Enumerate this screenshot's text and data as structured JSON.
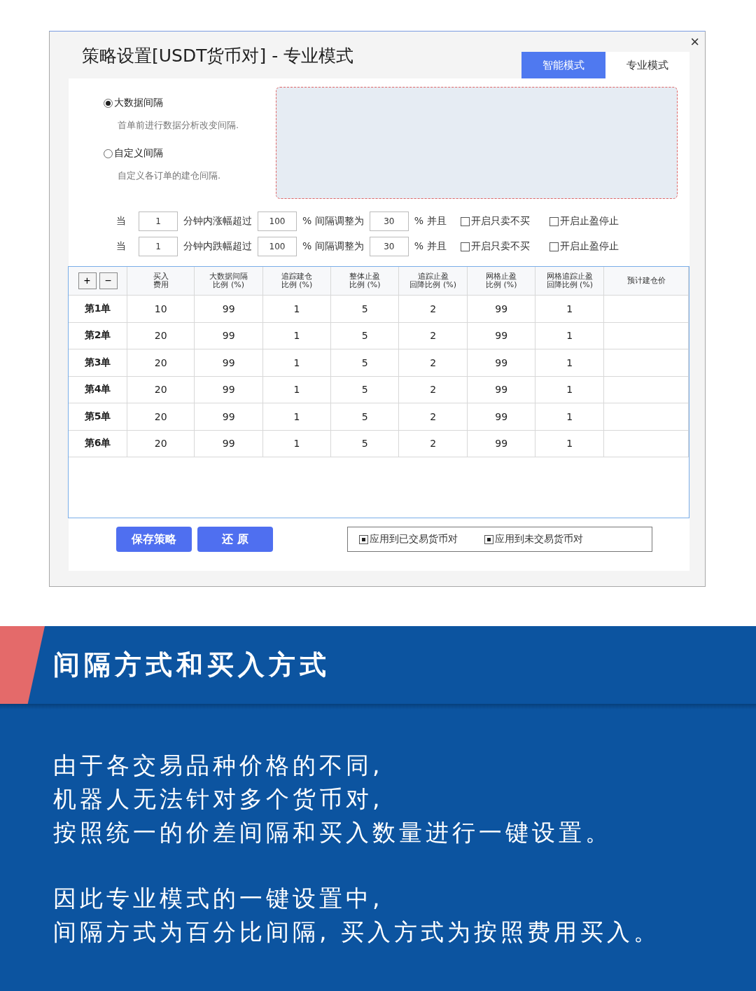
{
  "dialog": {
    "title": "策略设置[USDT货币对] - 专业模式",
    "close": "×",
    "tabs": [
      {
        "label": "智能模式",
        "selected": false
      },
      {
        "label": "专业模式",
        "selected": true
      }
    ],
    "interval_options": [
      {
        "label": "大数据间隔",
        "selected": true,
        "description": "首单前进行数据分析改变间隔."
      },
      {
        "label": "自定义间隔",
        "selected": false,
        "description": "自定义各订单的建仓间隔."
      }
    ],
    "conditions": [
      {
        "prefix": "当",
        "minutes": "1",
        "change_label": "分钟内涨幅超过",
        "threshold": "100",
        "adjust_label": "% 间隔调整为",
        "interval": "30",
        "and_label": "% 并且",
        "options": [
          {
            "label": "开启只卖不买",
            "checked": false
          },
          {
            "label": "开启止盈停止",
            "checked": false
          }
        ]
      },
      {
        "prefix": "当",
        "minutes": "1",
        "change_label": "分钟内跌幅超过",
        "threshold": "100",
        "adjust_label": "% 间隔调整为",
        "interval": "30",
        "and_label": "% 并且",
        "options": [
          {
            "label": "开启只卖不买",
            "checked": false
          },
          {
            "label": "开启止盈停止",
            "checked": false
          }
        ]
      }
    ],
    "table": {
      "add": "+",
      "remove": "−",
      "columns": [
        "",
        [
          "买入",
          "费用"
        ],
        [
          "大数据间隔",
          "比例 (%)"
        ],
        [
          "追踪建仓",
          "比例 (%)"
        ],
        [
          "整体止盈",
          "比例 (%)"
        ],
        [
          "追踪止盈",
          "回降比例 (%)"
        ],
        [
          "网格止盈",
          "比例 (%)"
        ],
        [
          "网格追踪止盈",
          "回降比例 (%)"
        ],
        [
          "预计建仓价"
        ]
      ],
      "rows": [
        [
          "第1单",
          "10",
          "99",
          "1",
          "5",
          "2",
          "99",
          "1",
          ""
        ],
        [
          "第2单",
          "20",
          "99",
          "1",
          "5",
          "2",
          "99",
          "1",
          ""
        ],
        [
          "第3单",
          "20",
          "99",
          "1",
          "5",
          "2",
          "99",
          "1",
          ""
        ],
        [
          "第4单",
          "20",
          "99",
          "1",
          "5",
          "2",
          "99",
          "1",
          ""
        ],
        [
          "第5单",
          "20",
          "99",
          "1",
          "5",
          "2",
          "99",
          "1",
          ""
        ],
        [
          "第6单",
          "20",
          "99",
          "1",
          "5",
          "2",
          "99",
          "1",
          ""
        ]
      ]
    },
    "buttons": [
      "保存策略",
      "还 原"
    ],
    "apply_options": [
      {
        "label": "应用到已交易货币对",
        "checked": true
      },
      {
        "label": "应用到未交易货币对",
        "checked": true
      }
    ]
  },
  "banner": {
    "heading": "间隔方式和买入方式",
    "paragraphs": [
      [
        "由于各交易品种价格的不同,",
        "机器人无法针对多个货币对,",
        "按照统一的价差间隔和买入数量进行一键设置。"
      ],
      [
        "因此专业模式的一键设置中,",
        "间隔方式为百分比间隔, 买入方式为按照费用买入。"
      ]
    ]
  }
}
